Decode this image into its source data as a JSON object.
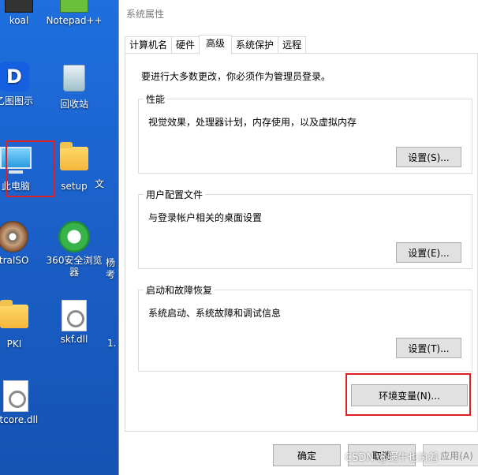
{
  "desktop": {
    "icons": [
      {
        "name": "koal",
        "label": "koal"
      },
      {
        "name": "notepad",
        "label": "Notepad++"
      },
      {
        "name": "yitu",
        "label": "乙图图示"
      },
      {
        "name": "recycle-bin",
        "label": "回收站"
      },
      {
        "name": "this-pc",
        "label": "此电脑"
      },
      {
        "name": "setup",
        "label": "setup"
      },
      {
        "name": "ultraiso",
        "label": "ltraISO"
      },
      {
        "name": "360browser",
        "label": "360安全浏览器"
      },
      {
        "name": "pki",
        "label": "PKI"
      },
      {
        "name": "skf-dll",
        "label": "skf.dll"
      },
      {
        "name": "htcore-dll",
        "label": "htcore.dll"
      }
    ],
    "partial_texts": [
      "文",
      "杨",
      "考",
      "1."
    ]
  },
  "dialog": {
    "title": "系统属性",
    "tabs": [
      {
        "label": "计算机名",
        "active": false
      },
      {
        "label": "硬件",
        "active": false
      },
      {
        "label": "高级",
        "active": true
      },
      {
        "label": "系统保护",
        "active": false
      },
      {
        "label": "远程",
        "active": false
      }
    ],
    "intro": "要进行大多数更改，你必须作为管理员登录。",
    "groups": {
      "performance": {
        "title": "性能",
        "desc": "视觉效果，处理器计划，内存使用，以及虚拟内存",
        "button": "设置(S)..."
      },
      "profiles": {
        "title": "用户配置文件",
        "desc": "与登录帐户相关的桌面设置",
        "button": "设置(E)..."
      },
      "startup": {
        "title": "启动和故障恢复",
        "desc": "系统启动、系统故障和调试信息",
        "button": "设置(T)..."
      }
    },
    "env_button": "环境变量(N)...",
    "footer": {
      "ok": "确定",
      "cancel": "取消",
      "apply": "应用(A)"
    }
  },
  "watermark": "CSDN @蜗牛也执着",
  "colors": {
    "desktop_bg": "#1a5fc7",
    "highlight_red": "#e02020",
    "button_bg": "#e1e1e1"
  }
}
